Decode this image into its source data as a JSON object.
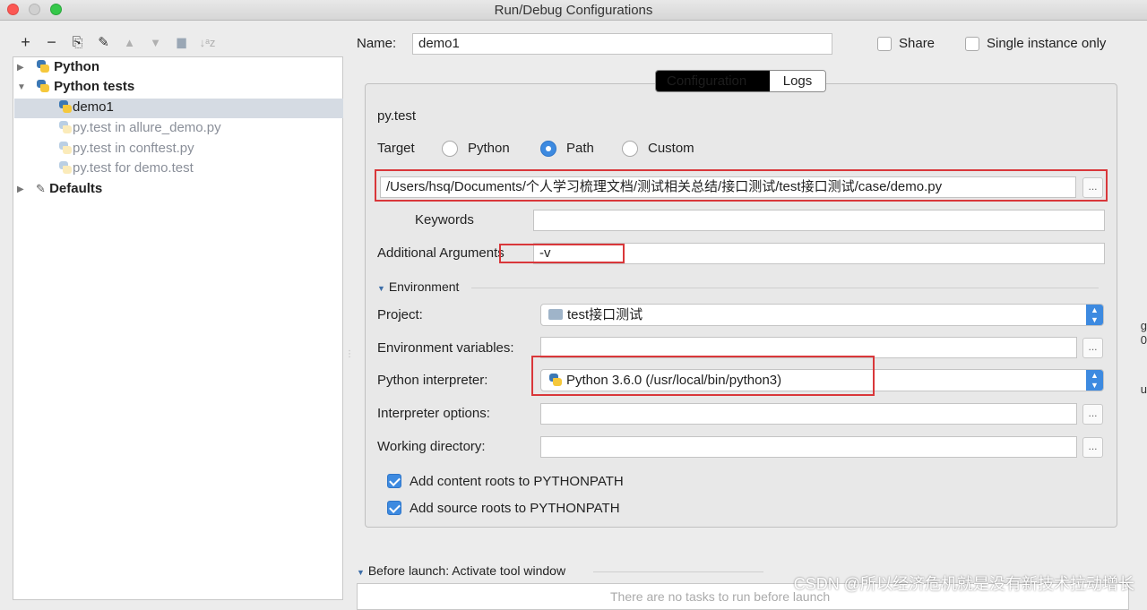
{
  "window": {
    "title": "Run/Debug Configurations"
  },
  "toolbar": {
    "add": "+",
    "remove": "−",
    "copy": "⎘",
    "edit_defaults": "✎",
    "move_up": "▲",
    "move_down": "▼",
    "folder": "▆",
    "sort": "↓ᵃz"
  },
  "tree": {
    "items": [
      {
        "label": "Python",
        "bold": true,
        "icon": "python-icon"
      },
      {
        "label": "Python tests",
        "bold": true,
        "icon": "python-tests-icon"
      },
      {
        "label": "demo1",
        "selected": true,
        "icon": "python-test-config-icon"
      },
      {
        "label": "py.test in allure_demo.py",
        "dimmed": true,
        "icon": "python-test-config-icon"
      },
      {
        "label": "py.test in conftest.py",
        "dimmed": true,
        "icon": "python-test-config-icon"
      },
      {
        "label": "py.test for demo.test",
        "dimmed": true,
        "icon": "python-test-config-icon"
      },
      {
        "label": "Defaults",
        "bold": true,
        "icon": "wrench-icon"
      }
    ]
  },
  "header": {
    "name_label": "Name:",
    "name_value": "demo1",
    "share_label": "Share",
    "single_instance_label": "Single instance only"
  },
  "tabs": {
    "configuration": "Configuration",
    "logs": "Logs"
  },
  "config": {
    "runner": "py.test",
    "target_label": "Target",
    "target_options": [
      "Python",
      "Path",
      "Custom"
    ],
    "target_selected": "Path",
    "path_value": "/Users/hsq/Documents/个人学习梳理文档/测试相关总结/接口测试/test接口测试/case/demo.py",
    "keywords_label": "Keywords",
    "keywords_value": "",
    "additional_args_label": "Additional Arguments",
    "additional_args_value": "-v",
    "environment_label": "Environment",
    "project_label": "Project:",
    "project_value": "test接口测试",
    "env_vars_label": "Environment variables:",
    "env_vars_value": "",
    "interpreter_label": "Python interpreter:",
    "interpreter_value": "Python 3.6.0 (/usr/local/bin/python3)",
    "interp_options_label": "Interpreter options:",
    "interp_options_value": "",
    "working_dir_label": "Working directory:",
    "working_dir_value": "",
    "add_content_roots_label": "Add content roots to PYTHONPATH",
    "add_content_roots_checked": true,
    "add_source_roots_label": "Add source roots to PYTHONPATH",
    "add_source_roots_checked": true
  },
  "before_launch": {
    "label": "Before launch: Activate tool window",
    "empty_text": "There are no tasks to run before launch"
  },
  "ellipsis": "...",
  "watermark": "CSDN @所以经济危机就是没有新技术拉动增长",
  "edge_fragments": [
    "g",
    "0",
    "u"
  ],
  "colors": {
    "accent": "#3d8ae0",
    "annotation_red": "#d9373a",
    "selection": "#d5dbe3"
  }
}
